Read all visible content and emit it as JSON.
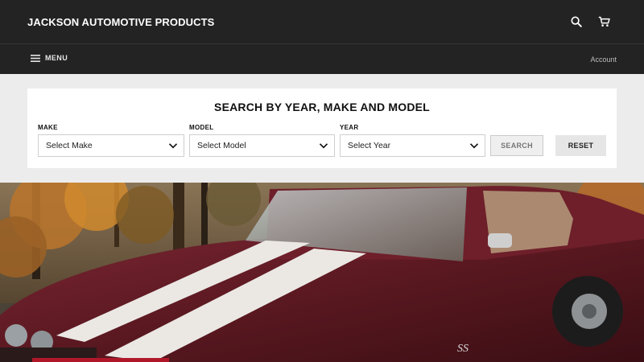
{
  "header": {
    "brand": "JACKSON AUTOMOTIVE PRODUCTS",
    "icons": [
      "search-icon",
      "cart-icon"
    ]
  },
  "nav": {
    "menu_label": "MENU",
    "account_label": "Account"
  },
  "search": {
    "title": "SEARCH BY YEAR, MAKE AND MODEL",
    "fields": [
      {
        "label": "MAKE",
        "value": "Select Make"
      },
      {
        "label": "MODEL",
        "value": "Select Model"
      },
      {
        "label": "YEAR",
        "value": "Select Year"
      }
    ],
    "search_button": "SEARCH",
    "reset_button": "RESET"
  },
  "hero": {
    "badge_text": "SS",
    "colors": {
      "car_body": "#5e1a22",
      "stripe": "#e9e6e2",
      "foliage": "#c07a2a"
    }
  }
}
